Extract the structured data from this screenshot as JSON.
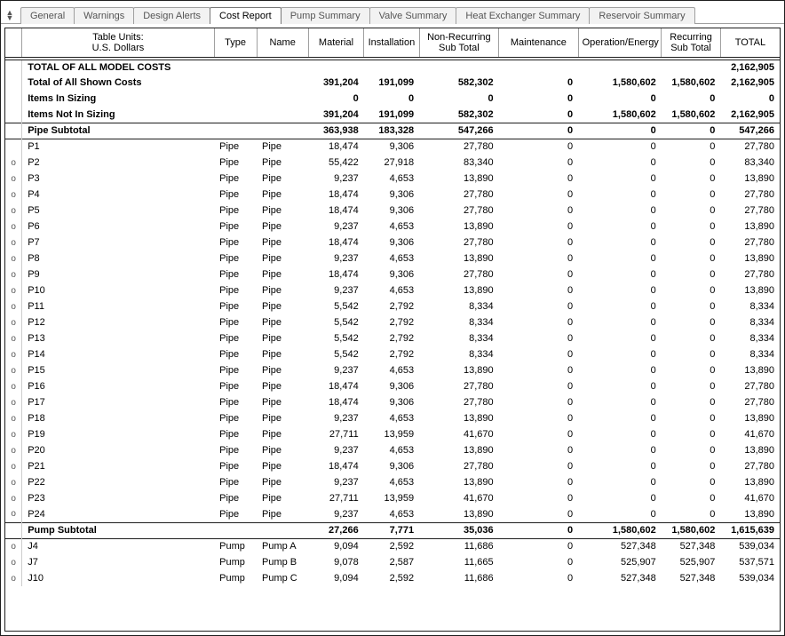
{
  "tabs": [
    "General",
    "Warnings",
    "Design Alerts",
    "Cost Report",
    "Pump Summary",
    "Valve Summary",
    "Heat Exchanger Summary",
    "Reservoir Summary"
  ],
  "activeTab": 3,
  "header": {
    "unitsLine1": "Table Units:",
    "unitsLine2": "U.S. Dollars",
    "cols": [
      "Type",
      "Name",
      "Material",
      "Installation",
      "Non-Recurring\nSub Total",
      "Maintenance",
      "Operation/Energy",
      "Recurring\nSub Total",
      "TOTAL"
    ]
  },
  "grandTotalLabel": "TOTAL OF ALL MODEL COSTS",
  "grandTotalValue": "2,162,905",
  "summaryRows": [
    {
      "label": "Total of All Shown Costs",
      "material": "391,204",
      "installation": "191,099",
      "nr": "582,302",
      "maint": "0",
      "op": "1,580,602",
      "rec": "1,580,602",
      "total": "2,162,905"
    },
    {
      "label": "Items In Sizing",
      "material": "0",
      "installation": "0",
      "nr": "0",
      "maint": "0",
      "op": "0",
      "rec": "0",
      "total": "0"
    },
    {
      "label": "Items Not In Sizing",
      "material": "391,204",
      "installation": "191,099",
      "nr": "582,302",
      "maint": "0",
      "op": "1,580,602",
      "rec": "1,580,602",
      "total": "2,162,905"
    }
  ],
  "pipeSubtotal": {
    "label": "Pipe Subtotal",
    "material": "363,938",
    "installation": "183,328",
    "nr": "547,266",
    "maint": "0",
    "op": "0",
    "rec": "0",
    "total": "547,266"
  },
  "pipeRows": [
    {
      "mark": "",
      "id": "P1",
      "type": "Pipe",
      "name": "Pipe",
      "material": "18,474",
      "installation": "9,306",
      "nr": "27,780",
      "maint": "0",
      "op": "0",
      "rec": "0",
      "total": "27,780"
    },
    {
      "mark": "o",
      "id": "P2",
      "type": "Pipe",
      "name": "Pipe",
      "material": "55,422",
      "installation": "27,918",
      "nr": "83,340",
      "maint": "0",
      "op": "0",
      "rec": "0",
      "total": "83,340"
    },
    {
      "mark": "o",
      "id": "P3",
      "type": "Pipe",
      "name": "Pipe",
      "material": "9,237",
      "installation": "4,653",
      "nr": "13,890",
      "maint": "0",
      "op": "0",
      "rec": "0",
      "total": "13,890"
    },
    {
      "mark": "o",
      "id": "P4",
      "type": "Pipe",
      "name": "Pipe",
      "material": "18,474",
      "installation": "9,306",
      "nr": "27,780",
      "maint": "0",
      "op": "0",
      "rec": "0",
      "total": "27,780"
    },
    {
      "mark": "o",
      "id": "P5",
      "type": "Pipe",
      "name": "Pipe",
      "material": "18,474",
      "installation": "9,306",
      "nr": "27,780",
      "maint": "0",
      "op": "0",
      "rec": "0",
      "total": "27,780"
    },
    {
      "mark": "o",
      "id": "P6",
      "type": "Pipe",
      "name": "Pipe",
      "material": "9,237",
      "installation": "4,653",
      "nr": "13,890",
      "maint": "0",
      "op": "0",
      "rec": "0",
      "total": "13,890"
    },
    {
      "mark": "o",
      "id": "P7",
      "type": "Pipe",
      "name": "Pipe",
      "material": "18,474",
      "installation": "9,306",
      "nr": "27,780",
      "maint": "0",
      "op": "0",
      "rec": "0",
      "total": "27,780"
    },
    {
      "mark": "o",
      "id": "P8",
      "type": "Pipe",
      "name": "Pipe",
      "material": "9,237",
      "installation": "4,653",
      "nr": "13,890",
      "maint": "0",
      "op": "0",
      "rec": "0",
      "total": "13,890"
    },
    {
      "mark": "o",
      "id": "P9",
      "type": "Pipe",
      "name": "Pipe",
      "material": "18,474",
      "installation": "9,306",
      "nr": "27,780",
      "maint": "0",
      "op": "0",
      "rec": "0",
      "total": "27,780"
    },
    {
      "mark": "o",
      "id": "P10",
      "type": "Pipe",
      "name": "Pipe",
      "material": "9,237",
      "installation": "4,653",
      "nr": "13,890",
      "maint": "0",
      "op": "0",
      "rec": "0",
      "total": "13,890"
    },
    {
      "mark": "o",
      "id": "P11",
      "type": "Pipe",
      "name": "Pipe",
      "material": "5,542",
      "installation": "2,792",
      "nr": "8,334",
      "maint": "0",
      "op": "0",
      "rec": "0",
      "total": "8,334"
    },
    {
      "mark": "o",
      "id": "P12",
      "type": "Pipe",
      "name": "Pipe",
      "material": "5,542",
      "installation": "2,792",
      "nr": "8,334",
      "maint": "0",
      "op": "0",
      "rec": "0",
      "total": "8,334"
    },
    {
      "mark": "o",
      "id": "P13",
      "type": "Pipe",
      "name": "Pipe",
      "material": "5,542",
      "installation": "2,792",
      "nr": "8,334",
      "maint": "0",
      "op": "0",
      "rec": "0",
      "total": "8,334"
    },
    {
      "mark": "o",
      "id": "P14",
      "type": "Pipe",
      "name": "Pipe",
      "material": "5,542",
      "installation": "2,792",
      "nr": "8,334",
      "maint": "0",
      "op": "0",
      "rec": "0",
      "total": "8,334"
    },
    {
      "mark": "o",
      "id": "P15",
      "type": "Pipe",
      "name": "Pipe",
      "material": "9,237",
      "installation": "4,653",
      "nr": "13,890",
      "maint": "0",
      "op": "0",
      "rec": "0",
      "total": "13,890"
    },
    {
      "mark": "o",
      "id": "P16",
      "type": "Pipe",
      "name": "Pipe",
      "material": "18,474",
      "installation": "9,306",
      "nr": "27,780",
      "maint": "0",
      "op": "0",
      "rec": "0",
      "total": "27,780"
    },
    {
      "mark": "o",
      "id": "P17",
      "type": "Pipe",
      "name": "Pipe",
      "material": "18,474",
      "installation": "9,306",
      "nr": "27,780",
      "maint": "0",
      "op": "0",
      "rec": "0",
      "total": "27,780"
    },
    {
      "mark": "o",
      "id": "P18",
      "type": "Pipe",
      "name": "Pipe",
      "material": "9,237",
      "installation": "4,653",
      "nr": "13,890",
      "maint": "0",
      "op": "0",
      "rec": "0",
      "total": "13,890"
    },
    {
      "mark": "o",
      "id": "P19",
      "type": "Pipe",
      "name": "Pipe",
      "material": "27,711",
      "installation": "13,959",
      "nr": "41,670",
      "maint": "0",
      "op": "0",
      "rec": "0",
      "total": "41,670"
    },
    {
      "mark": "o",
      "id": "P20",
      "type": "Pipe",
      "name": "Pipe",
      "material": "9,237",
      "installation": "4,653",
      "nr": "13,890",
      "maint": "0",
      "op": "0",
      "rec": "0",
      "total": "13,890"
    },
    {
      "mark": "o",
      "id": "P21",
      "type": "Pipe",
      "name": "Pipe",
      "material": "18,474",
      "installation": "9,306",
      "nr": "27,780",
      "maint": "0",
      "op": "0",
      "rec": "0",
      "total": "27,780"
    },
    {
      "mark": "o",
      "id": "P22",
      "type": "Pipe",
      "name": "Pipe",
      "material": "9,237",
      "installation": "4,653",
      "nr": "13,890",
      "maint": "0",
      "op": "0",
      "rec": "0",
      "total": "13,890"
    },
    {
      "mark": "o",
      "id": "P23",
      "type": "Pipe",
      "name": "Pipe",
      "material": "27,711",
      "installation": "13,959",
      "nr": "41,670",
      "maint": "0",
      "op": "0",
      "rec": "0",
      "total": "41,670"
    },
    {
      "mark": "o",
      "id": "P24",
      "type": "Pipe",
      "name": "Pipe",
      "material": "9,237",
      "installation": "4,653",
      "nr": "13,890",
      "maint": "0",
      "op": "0",
      "rec": "0",
      "total": "13,890"
    }
  ],
  "pumpSubtotal": {
    "label": "Pump Subtotal",
    "material": "27,266",
    "installation": "7,771",
    "nr": "35,036",
    "maint": "0",
    "op": "1,580,602",
    "rec": "1,580,602",
    "total": "1,615,639"
  },
  "pumpRows": [
    {
      "mark": "o",
      "id": "J4",
      "type": "Pump",
      "name": "Pump A",
      "material": "9,094",
      "installation": "2,592",
      "nr": "11,686",
      "maint": "0",
      "op": "527,348",
      "rec": "527,348",
      "total": "539,034"
    },
    {
      "mark": "o",
      "id": "J7",
      "type": "Pump",
      "name": "Pump B",
      "material": "9,078",
      "installation": "2,587",
      "nr": "11,665",
      "maint": "0",
      "op": "525,907",
      "rec": "525,907",
      "total": "537,571"
    },
    {
      "mark": "o",
      "id": "J10",
      "type": "Pump",
      "name": "Pump C",
      "material": "9,094",
      "installation": "2,592",
      "nr": "11,686",
      "maint": "0",
      "op": "527,348",
      "rec": "527,348",
      "total": "539,034"
    }
  ]
}
